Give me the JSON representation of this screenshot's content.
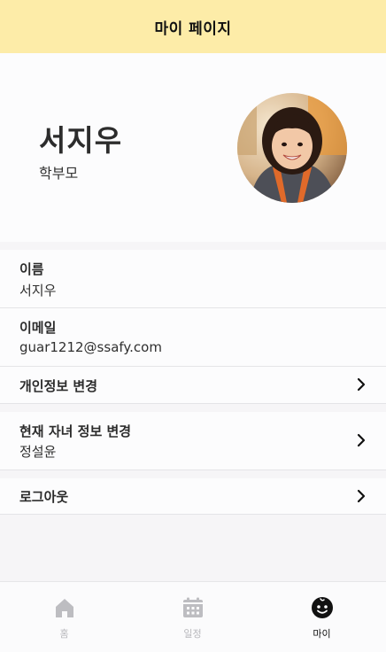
{
  "header": {
    "title": "마이 페이지"
  },
  "profile": {
    "name": "서지우",
    "role": "학부모"
  },
  "info": {
    "name_label": "이름",
    "name_value": "서지우",
    "email_label": "이메일",
    "email_value": "guar1212@ssafy.com"
  },
  "menu": {
    "privacy_label": "개인정보 변경",
    "child_label": "현재 자녀 정보 변경",
    "child_value": "정설윤",
    "logout_label": "로그아웃"
  },
  "tabs": [
    {
      "label": "홈",
      "icon": "home-icon",
      "active": false
    },
    {
      "label": "일정",
      "icon": "calendar-icon",
      "active": false
    },
    {
      "label": "마이",
      "icon": "face-icon",
      "active": true
    }
  ],
  "colors": {
    "header_bg": "#fdeca8",
    "active_tab": "#111111",
    "inactive_tab": "#b7b7bb"
  }
}
